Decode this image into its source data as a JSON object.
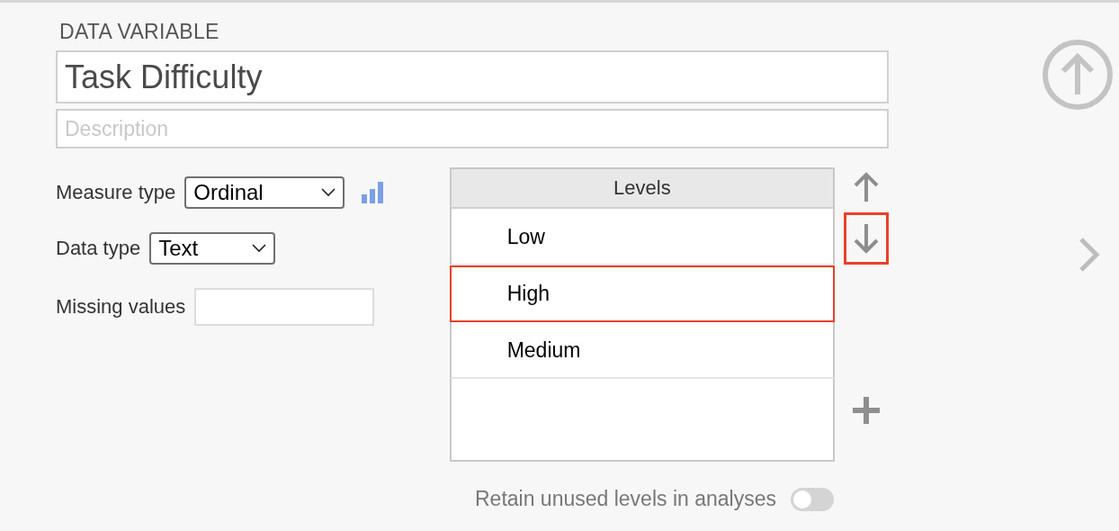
{
  "section_title": "DATA VARIABLE",
  "name_field": {
    "value": "Task Difficulty"
  },
  "description_field": {
    "placeholder": "Description"
  },
  "measure_type": {
    "label": "Measure type",
    "value": "Ordinal"
  },
  "data_type": {
    "label": "Data type",
    "value": "Text"
  },
  "missing_values": {
    "label": "Missing values"
  },
  "levels": {
    "header": "Levels",
    "items": [
      {
        "label": "Low",
        "selected": false
      },
      {
        "label": "High",
        "selected": true
      },
      {
        "label": "Medium",
        "selected": false
      }
    ]
  },
  "level_buttons": [
    {
      "kind": "up",
      "highlighted": false
    },
    {
      "kind": "down",
      "highlighted": true
    },
    {
      "kind": "add",
      "highlighted": false
    }
  ],
  "retain_unused": {
    "label": "Retain unused levels in analyses",
    "on": false
  }
}
